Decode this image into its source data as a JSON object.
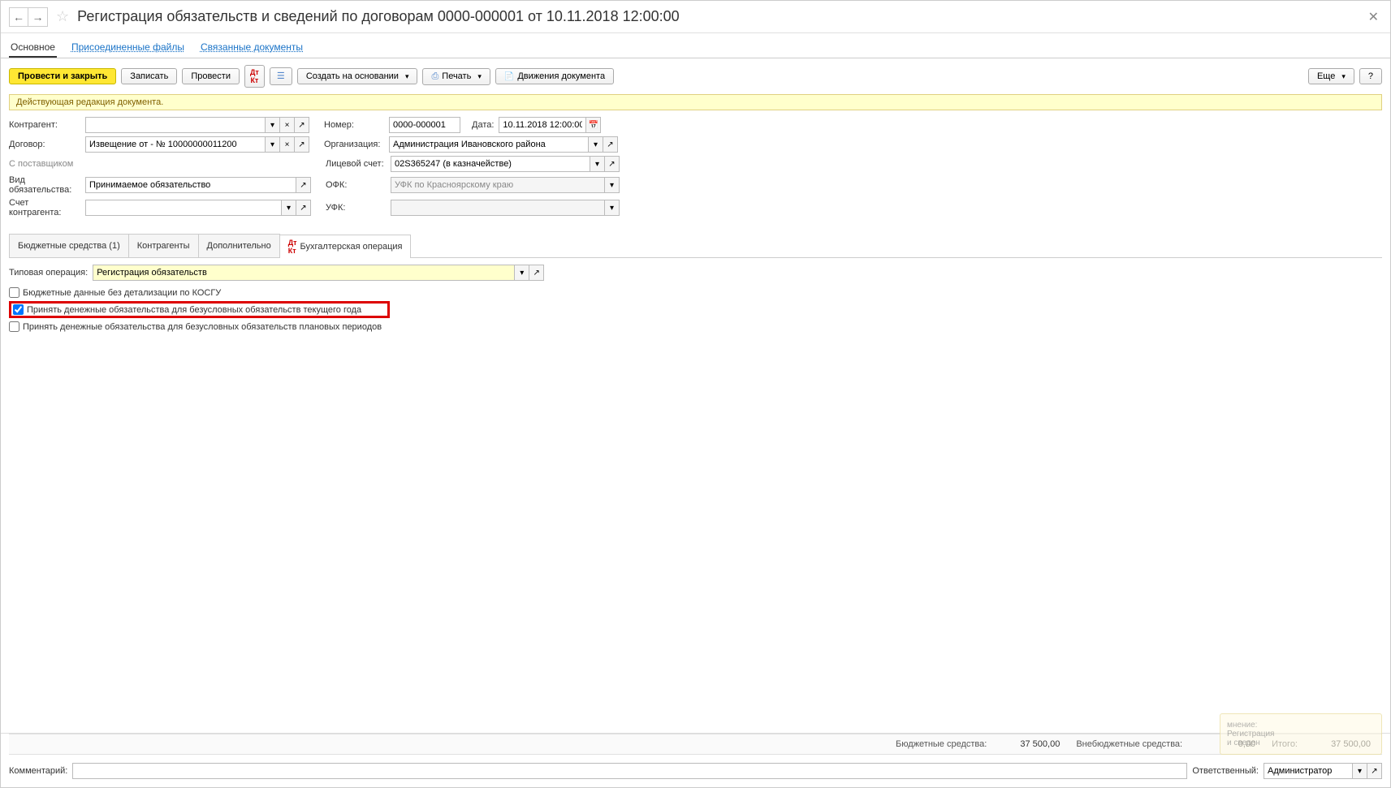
{
  "header": {
    "title": "Регистрация обязательств и сведений по договорам 0000-000001 от 10.11.2018 12:00:00"
  },
  "nav_tabs": {
    "main": "Основное",
    "files": "Присоединенные файлы",
    "linked": "Связанные документы"
  },
  "toolbar": {
    "post_close": "Провести и закрыть",
    "save": "Записать",
    "post": "Провести",
    "create_based": "Создать на основании",
    "print": "Печать",
    "movements": "Движения документа",
    "more": "Еще",
    "help": "?"
  },
  "status": "Действующая редакция документа.",
  "form": {
    "kontragent_label": "Контрагент:",
    "kontragent_value": "",
    "dogovor_label": "Договор:",
    "dogovor_value": "Извещение от - № 10000000011200",
    "supplier_label": "С поставщиком",
    "vid_label": "Вид обязательства:",
    "vid_value": "Принимаемое обязательство",
    "schet_label": "Счет контрагента:",
    "nomer_label": "Номер:",
    "nomer_value": "0000-000001",
    "data_label": "Дата:",
    "data_value": "10.11.2018 12:00:00",
    "org_label": "Организация:",
    "org_value": "Администрация Ивановского района",
    "ls_label": "Лицевой счет:",
    "ls_value": "02S365247 (в казначействе)",
    "ofk_label": "ОФК:",
    "ofk_value": "УФК по Красноярскому краю",
    "ufk_label": "УФК:"
  },
  "sub_tabs": {
    "budget": "Бюджетные средства (1)",
    "kontragenty": "Контрагенты",
    "additional": "Дополнительно",
    "accounting": "Бухгалтерская операция"
  },
  "accounting_tab": {
    "typop_label": "Типовая операция:",
    "typop_value": "Регистрация обязательств",
    "cb1": "Бюджетные данные без детализации по КОСГУ",
    "cb2": "Принять денежные обязательства для безусловных обязательств текущего года",
    "cb3": "Принять денежные обязательства для безусловных обязательств плановых периодов"
  },
  "totals": {
    "budget_label": "Бюджетные средства:",
    "budget_value": "37 500,00",
    "nonbudget_label": "Внебюджетные средства:",
    "nonbudget_value": "0,00",
    "total_label": "Итого:",
    "total_value": "37 500,00"
  },
  "footer": {
    "comment_label": "Комментарий:",
    "resp_label": "Ответственный:",
    "resp_value": "Администратор"
  },
  "notif": {
    "title": "мнение:",
    "line1": "Регистрация",
    "line2": "и сведен"
  }
}
